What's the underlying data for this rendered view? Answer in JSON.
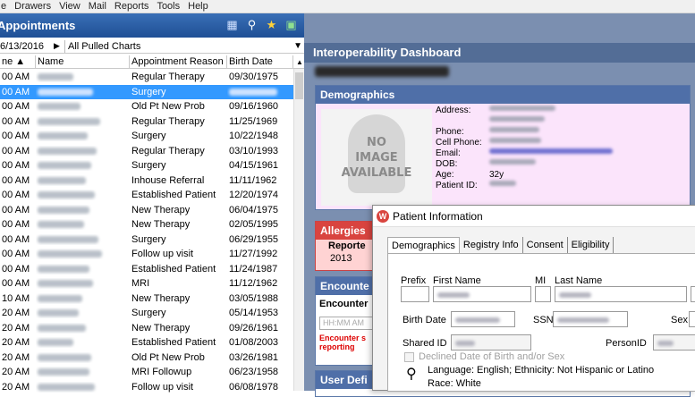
{
  "menu": [
    "e",
    "Drawers",
    "View",
    "Mail",
    "Reports",
    "Tools",
    "Help"
  ],
  "left": {
    "title": "Appointments",
    "filter_date": "6/13/2016",
    "filter_label": "All Pulled Charts",
    "columns": {
      "time": "ne ▲",
      "name": "Name",
      "reason": "Appointment Reason",
      "dob": "Birth Date"
    },
    "rows": [
      {
        "time": "00 AM",
        "reason": "Regular Therapy",
        "dob": "09/30/1975"
      },
      {
        "time": "00 AM",
        "reason": "Surgery",
        "dob": "",
        "selected": true
      },
      {
        "time": "00 AM",
        "reason": "Old Pt New Prob",
        "dob": "09/16/1960"
      },
      {
        "time": "00 AM",
        "reason": "Regular Therapy",
        "dob": "11/25/1969"
      },
      {
        "time": "00 AM",
        "reason": "Surgery",
        "dob": "10/22/1948"
      },
      {
        "time": "00 AM",
        "reason": "Regular Therapy",
        "dob": "03/10/1993"
      },
      {
        "time": "00 AM",
        "reason": "Surgery",
        "dob": "04/15/1961"
      },
      {
        "time": "00 AM",
        "reason": "Inhouse Referral",
        "dob": "11/11/1962"
      },
      {
        "time": "00 AM",
        "reason": "Established Patient",
        "dob": "12/20/1974"
      },
      {
        "time": "00 AM",
        "reason": "New Therapy",
        "dob": "06/04/1975"
      },
      {
        "time": "00 AM",
        "reason": "New Therapy",
        "dob": "02/05/1995"
      },
      {
        "time": "00 AM",
        "reason": "Surgery",
        "dob": "06/29/1955"
      },
      {
        "time": "00 AM",
        "reason": "Follow up visit",
        "dob": "11/27/1992"
      },
      {
        "time": "00 AM",
        "reason": "Established Patient",
        "dob": "11/24/1987"
      },
      {
        "time": "00 AM",
        "reason": "MRI",
        "dob": "11/12/1962"
      },
      {
        "time": "10 AM",
        "reason": "New Therapy",
        "dob": "03/05/1988"
      },
      {
        "time": "20 AM",
        "reason": "Surgery",
        "dob": "05/14/1953"
      },
      {
        "time": "20 AM",
        "reason": "New Therapy",
        "dob": "09/26/1961"
      },
      {
        "time": "20 AM",
        "reason": "Established Patient",
        "dob": "01/08/2003"
      },
      {
        "time": "20 AM",
        "reason": "Old Pt New Prob",
        "dob": "03/26/1981"
      },
      {
        "time": "20 AM",
        "reason": "MRI Followup",
        "dob": "06/23/1958"
      },
      {
        "time": "20 AM",
        "reason": "Follow up visit",
        "dob": "06/08/1978"
      }
    ]
  },
  "dashboard": {
    "title": "Interoperability Dashboard",
    "demographics": {
      "title": "Demographics",
      "no_image": [
        "NO",
        "IMAGE",
        "AVAILABLE"
      ],
      "fields": [
        "Address:",
        "",
        "Phone:",
        "Cell Phone:",
        "Email:",
        "DOB:",
        "Age:",
        "Patient ID:"
      ],
      "age": "32y"
    },
    "allergies": {
      "title": "Allergies",
      "col": "Reporte",
      "year": "2013"
    },
    "encounter": {
      "title": "Encounte",
      "label": "Encounter",
      "placeholder": "HH:MM AM",
      "error": "Encounter s reporting"
    },
    "userdef": {
      "title": "User Defi"
    }
  },
  "dialog": {
    "title": "Patient Information",
    "tabs": [
      "Demographics",
      "Registry Info",
      "Consent",
      "Eligibility"
    ],
    "labels": {
      "prefix": "Prefix",
      "first": "First Name",
      "mi": "MI",
      "last": "Last Name",
      "birth": "Birth Date",
      "ssn": "SSN",
      "sex": "Sex",
      "shared": "Shared ID",
      "person": "PersonID",
      "declined": "Declined Date of Birth and/or Sex",
      "language": "Language: English; Ethnicity: Not Hispanic or Latino",
      "race": "Race: White"
    }
  }
}
